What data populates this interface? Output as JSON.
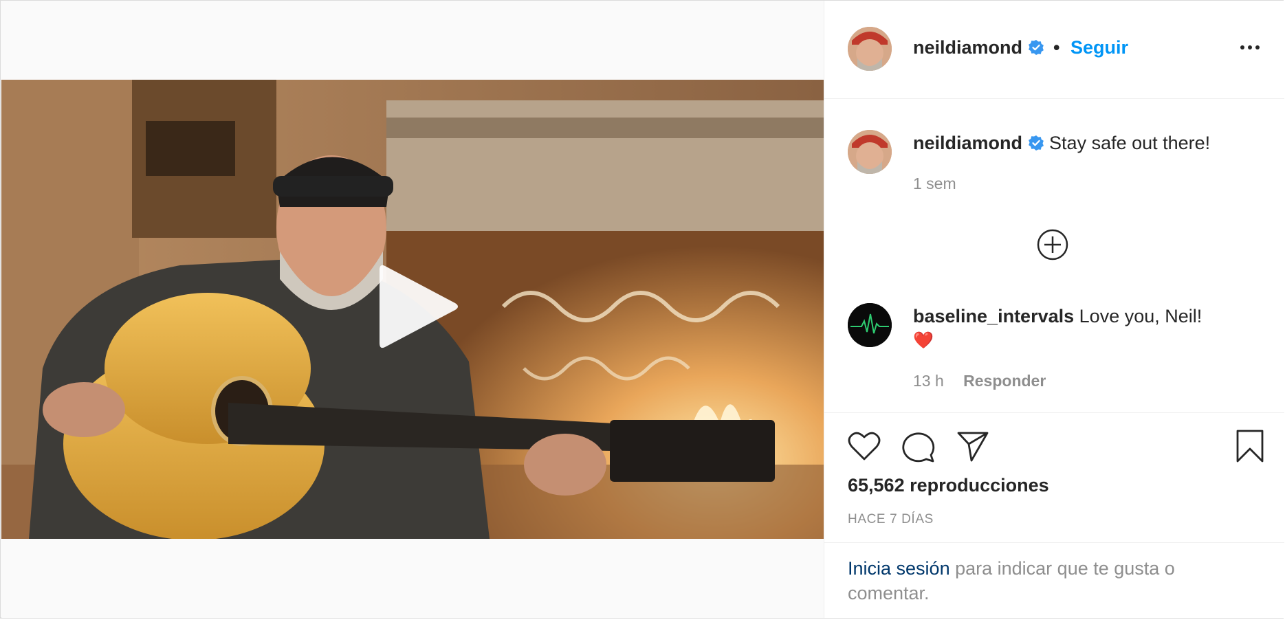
{
  "post": {
    "username": "neildiamond",
    "separator": "•",
    "follow_label": "Seguir",
    "more_icon": "more-options-icon",
    "verified_icon": "verified-badge-icon",
    "caption": {
      "username": "neildiamond",
      "text": "Stay safe out there!",
      "time": "1 sem"
    },
    "load_more_icon": "plus-circle-icon",
    "comments": [
      {
        "username": "baseline_intervals",
        "text": "Love you, Neil!",
        "emoji": "❤️",
        "time": "13 h",
        "reply_label": "Responder"
      }
    ],
    "actions": [
      "heart-icon",
      "comment-icon",
      "share-icon",
      "bookmark-icon"
    ],
    "views": "65,562 reproducciones",
    "age": "HACE 7 DÍAS",
    "login": {
      "link": "Inicia sesión",
      "text": " para indicar que te gusta o comentar."
    }
  },
  "video": {
    "play_icon": "play-icon"
  },
  "colors": {
    "accent": "#0095f6",
    "verified": "#3897f0",
    "link_dark": "#00376b",
    "muted": "#8e8e8e",
    "text": "#262626"
  }
}
